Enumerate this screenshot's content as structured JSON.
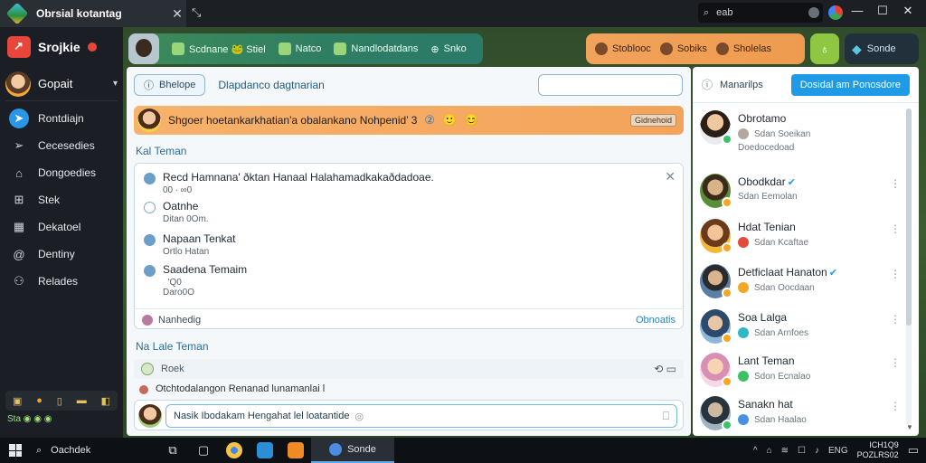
{
  "window": {
    "tab_title": "Obrsial kotantag",
    "tab_close": "✕",
    "new_tab": "⤡",
    "search_text": "eab",
    "controls": {
      "minimize": "—",
      "maximize": "☐",
      "close": "✕"
    }
  },
  "sidebar": {
    "brand": "Srojkie",
    "profile_name": "Gopait",
    "items": [
      {
        "label": "Rontdiajn",
        "icon": "compass-icon",
        "glyph": "➤"
      },
      {
        "label": "Cecesedies",
        "icon": "send-icon",
        "glyph": "➢"
      },
      {
        "label": "Dongoedies",
        "icon": "home-icon",
        "glyph": "⌂"
      },
      {
        "label": "Stek",
        "icon": "grid-icon",
        "glyph": "⊞"
      },
      {
        "label": "Dekatoel",
        "icon": "calendar-icon",
        "glyph": "▦"
      },
      {
        "label": "Dentiny",
        "icon": "at-icon",
        "glyph": "@"
      },
      {
        "label": "Relades",
        "icon": "people-icon",
        "glyph": "⚇"
      }
    ],
    "bottom_icons": [
      "▣",
      "●",
      "▯",
      "▬",
      "◧"
    ],
    "status_text": "Sta ◉ ◉ ◉"
  },
  "toolbar": {
    "green_items": [
      "Scdnane 🐸 Stiel",
      "Natco",
      "Nandlodatdans",
      "Snko"
    ],
    "orange_items": [
      "Stoblooc",
      "Sobiks",
      "Sholelas"
    ],
    "lime_glyph": "♁",
    "blue_label": "Sonde"
  },
  "main": {
    "pill_label": "Bhelope",
    "heading": "Dlapdanco dagtnarian",
    "banner_text": "Shgoer hoetankarkhatian'a obalankano Nohpenid’ 3",
    "banner_emoji": [
      "②",
      "🙂",
      "😊"
    ],
    "banner_tag": "Gidnehoid",
    "section1_title": "Kal Teman",
    "list": [
      {
        "title": "Recd Hamnana' ðktan Hanaal Halahamadkakaðdadoae.",
        "sub": "00  ∙  ∞0"
      },
      {
        "title": "Oatnhe",
        "sub": "Ditan 0Om."
      },
      {
        "title": "Napaan Tenkat",
        "sub": "Ortlo Hatan"
      },
      {
        "title": "Saadena Temaim",
        "sub": "  'Q0\nDaro0O"
      }
    ],
    "card_footer_label": "Nanhedig",
    "card_footer_link": "Obnoatis",
    "section2_title": "Na Lale Teman",
    "row2_text": "Roek",
    "row3_text": "Otchtodalangon Renanad lunamanlai l",
    "composer_text": "Nasik Ibodakam Hengahat lel loatantide",
    "composer_emoji": "◎",
    "send_glyph": "⎕"
  },
  "right": {
    "header": "Manarilps",
    "button_label": "Dosidal am Ponosdore",
    "contacts": [
      {
        "name": "Obrotamo",
        "sub": "Sdan Soeikan",
        "sub2": "Doedocedoad",
        "badge": "#3cc266",
        "subicon": "#b3a7a0",
        "verified": false
      },
      {
        "name": "Obodkdar",
        "sub": "Sdan Eemolan",
        "sub2": "",
        "badge": "#f5a623",
        "subicon": "",
        "verified": true
      },
      {
        "name": "Hdat Tenian",
        "sub": "Sdan Kcaftae",
        "sub2": "",
        "badge": "#f5a623",
        "subicon": "#e24a3b",
        "verified": false
      },
      {
        "name": "Detficlaat Hanaton",
        "sub": "Sdan Oocdaan",
        "sub2": "",
        "badge": "#f5a623",
        "subicon": "#f5a623",
        "verified": true
      },
      {
        "name": "Soa Lalga",
        "sub": "Sdan Arnfoes",
        "sub2": "",
        "badge": "#f5a623",
        "subicon": "#2db7c9",
        "verified": false
      },
      {
        "name": "Lant Teman",
        "sub": "Sdon Ecnalao",
        "sub2": "",
        "badge": "#f5a623",
        "subicon": "#3cc266",
        "verified": false
      },
      {
        "name": "Sanakn hat",
        "sub": "Sdan Haalao",
        "sub2": "",
        "badge": "#3cc266",
        "subicon": "#4a90e2",
        "verified": false
      }
    ]
  },
  "taskbar": {
    "search_label": "Oachdek",
    "active_app": "Sonde",
    "apps": [
      "task-view-icon",
      "folder-icon",
      "chrome-icon",
      "store-icon",
      "media-icon"
    ],
    "tray": [
      "^",
      "⌂",
      "≋",
      "☐",
      "♪",
      "ENG"
    ],
    "clock_time": "ICH1Q9",
    "clock_date": "POZLRS02"
  }
}
